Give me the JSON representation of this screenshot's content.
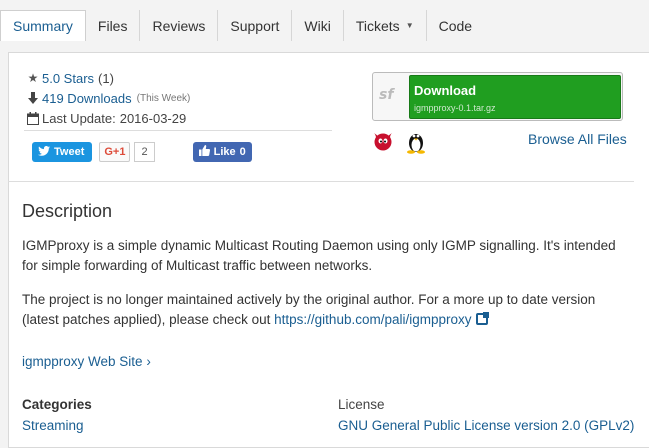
{
  "nav": {
    "tabs": [
      {
        "label": "Summary",
        "active": true
      },
      {
        "label": "Files"
      },
      {
        "label": "Reviews"
      },
      {
        "label": "Support"
      },
      {
        "label": "Wiki"
      },
      {
        "label": "Tickets",
        "has_dropdown": true
      },
      {
        "label": "Code"
      }
    ]
  },
  "stats": {
    "stars_label": "5.0 Stars",
    "stars_count": "(1)",
    "downloads_label": "419 Downloads",
    "downloads_period": "(This Week)",
    "last_update_label": "Last Update:",
    "last_update_date": "2016-03-29"
  },
  "social": {
    "tweet_label": "Tweet",
    "gplus_label": "G+1",
    "gplus_count": "2",
    "like_label": "Like",
    "like_count": "0"
  },
  "download": {
    "logo": "sf",
    "title": "Download",
    "filename": "igmpproxy-0.1.tar.gz",
    "browse_label": "Browse All Files",
    "os_icons": [
      "freebsd-icon",
      "linux-icon"
    ]
  },
  "description": {
    "heading": "Description",
    "paragraph1": "IGMPproxy is a simple dynamic Multicast Routing Daemon using only IGMP signalling. It's intended for simple forwarding of Multicast traffic between networks.",
    "paragraph2_text": "The project is no longer maintained actively by the original author. For a more up to date version (latest patches applied), please check out ",
    "paragraph2_link": "https://github.com/pali/igmpproxy"
  },
  "website_label": "igmpproxy Web Site",
  "categories": {
    "label": "Categories",
    "value": "Streaming"
  },
  "license": {
    "label": "License",
    "value": "GNU General Public License version 2.0 (GPLv2)"
  },
  "colors": {
    "link": "#1a5e91",
    "download_green": "#209e20",
    "twitter": "#1b95e0",
    "facebook": "#4267b2"
  }
}
